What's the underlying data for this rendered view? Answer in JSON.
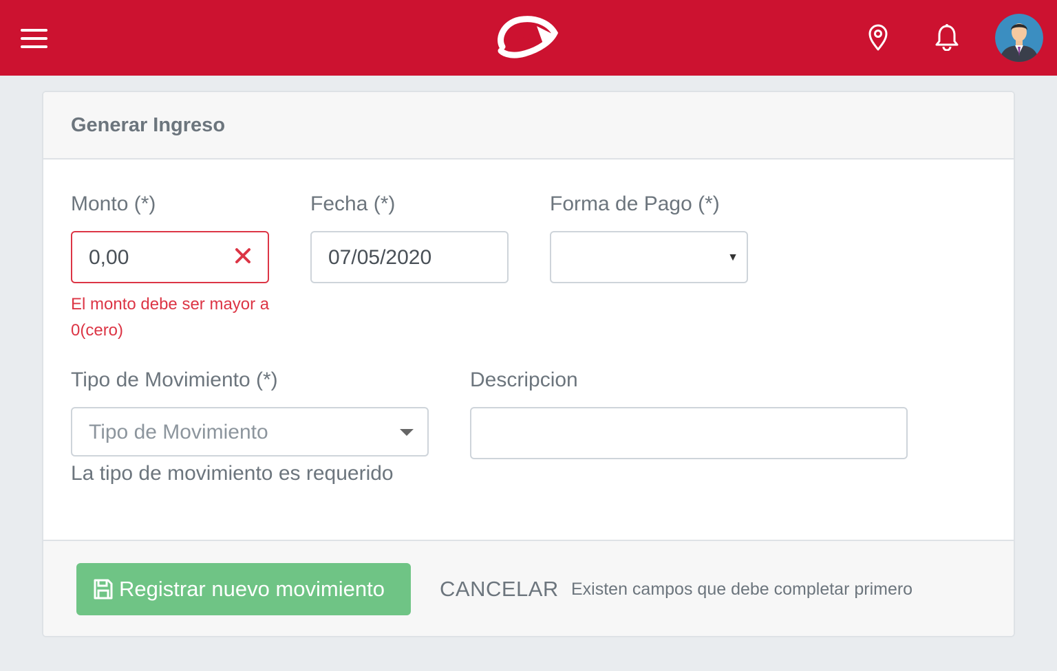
{
  "header": {
    "menu_icon": "hamburger-menu-icon",
    "logo_icon": "brand-logo",
    "location_icon": "map-pin-icon",
    "notifications_icon": "bell-icon",
    "avatar": "user-avatar",
    "colors": {
      "bar": "#cc1230",
      "icons": "#ffffff"
    }
  },
  "card": {
    "title": "Generar Ingreso"
  },
  "form": {
    "monto": {
      "label": "Monto (*)",
      "value": "0,00",
      "error": "El monto debe ser mayor a 0(cero)",
      "invalid_icon": "close-x-icon"
    },
    "fecha": {
      "label": "Fecha (*)",
      "value": "07/05/2020"
    },
    "forma_pago": {
      "label": "Forma de Pago (*)",
      "value": "",
      "caret": "▼"
    },
    "tipo_movimiento": {
      "label": "Tipo de Movimiento (*)",
      "placeholder": "Tipo de Movimiento",
      "help": "La tipo de movimiento es requerido"
    },
    "descripcion": {
      "label": "Descripcion",
      "value": ""
    }
  },
  "footer": {
    "save_label": "Registrar nuevo movimiento",
    "save_icon": "floppy-disk-icon",
    "cancel_label": "CANCELAR",
    "note": "Existen campos que debe completar primero",
    "colors": {
      "save_button": "#6fc485",
      "error": "#dc3545"
    }
  }
}
